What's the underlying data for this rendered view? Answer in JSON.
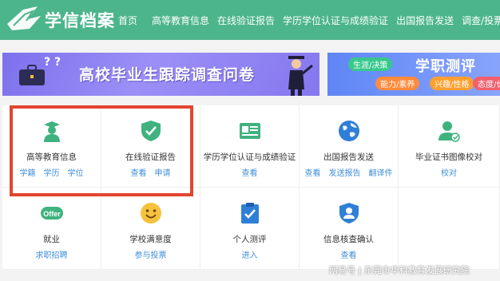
{
  "header": {
    "logo_text": "学信档案",
    "nav": [
      "首页",
      "高等教育信息",
      "在线验证报告",
      "学历学位认证与成绩验证",
      "出国报告发送",
      "调查/投票"
    ]
  },
  "banners": {
    "left_title": "高校毕业生跟踪调查问卷",
    "left_marks": "? ?",
    "right_title": "学职测评",
    "right_tags": [
      "生涯/决策",
      "能力/素养",
      "兴趣/性格",
      "态度/价"
    ]
  },
  "cards": [
    {
      "label": "高等教育信息",
      "links": [
        "学籍",
        "学历",
        "学位"
      ],
      "icon": "graduate-icon"
    },
    {
      "label": "在线验证报告",
      "links": [
        "查看",
        "申请"
      ],
      "icon": "shield-check-icon"
    },
    {
      "label": "学历学位认证与成绩验证",
      "links": [
        "查看"
      ],
      "icon": "certificate-icon"
    },
    {
      "label": "出国报告发送",
      "links": [
        "查看",
        "发送报告",
        "翻译件"
      ],
      "icon": "globe-icon"
    },
    {
      "label": "毕业证书图像校对",
      "links": [
        "校对"
      ],
      "icon": "user-check-icon"
    },
    {
      "label": "就业",
      "links": [
        "求职招聘"
      ],
      "icon": "offer-badge-icon",
      "badge": "Offer"
    },
    {
      "label": "学校满意度",
      "links": [
        "参与投票"
      ],
      "icon": "smiley-icon"
    },
    {
      "label": "个人测评",
      "links": [
        "进入"
      ],
      "icon": "clipboard-check-icon"
    },
    {
      "label": "信息核查确认",
      "links": [
        "查看"
      ],
      "icon": "user-shield-icon"
    },
    {
      "label": "",
      "links": [],
      "icon": ""
    }
  ],
  "watermark": "网易号 | 东莞市华科教育发展研究院",
  "colors": {
    "header": "#4cb58b",
    "highlight": "#e2452f",
    "link": "#3f8fd9"
  }
}
